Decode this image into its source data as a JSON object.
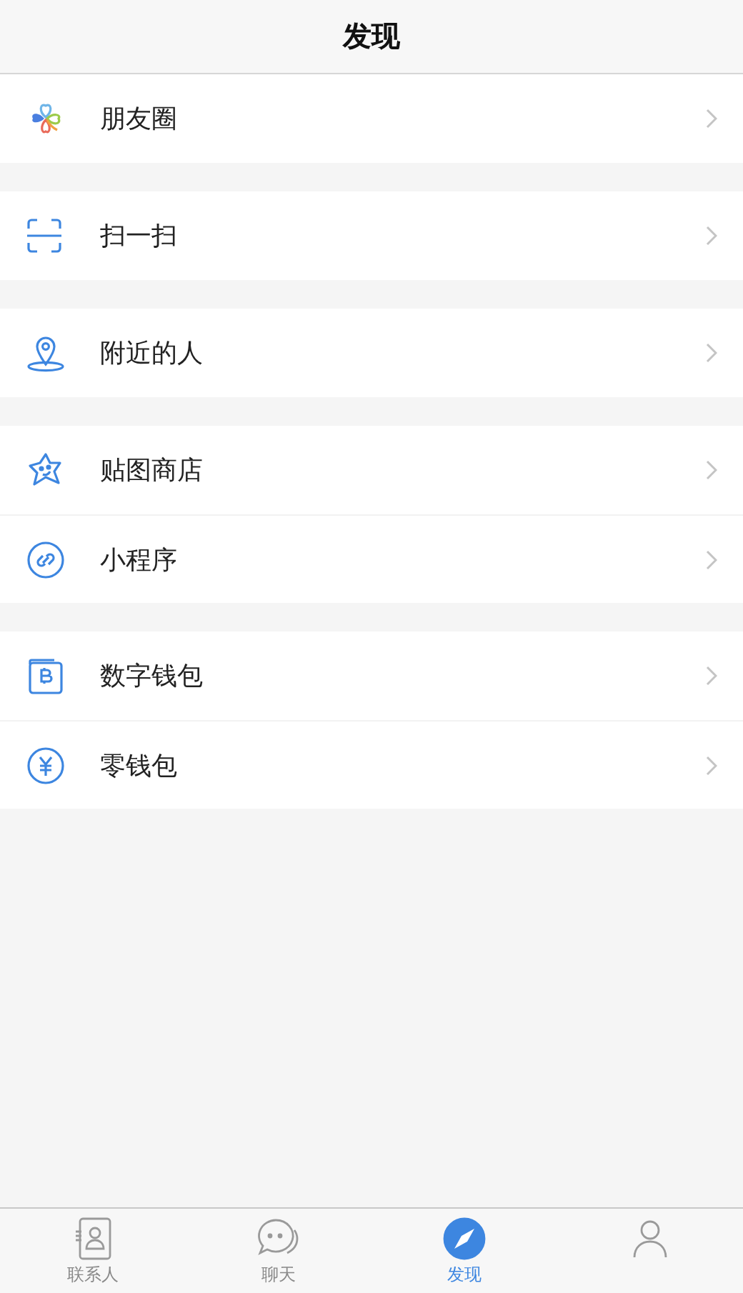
{
  "header": {
    "title": "发现"
  },
  "groups": [
    {
      "items": [
        {
          "kind": "moments",
          "label": "朋友圈"
        }
      ]
    },
    {
      "items": [
        {
          "kind": "scan",
          "label": "扫一扫"
        }
      ]
    },
    {
      "items": [
        {
          "kind": "nearby",
          "label": "附近的人"
        }
      ]
    },
    {
      "items": [
        {
          "kind": "sticker",
          "label": "贴图商店"
        },
        {
          "kind": "miniprogram",
          "label": "小程序"
        }
      ]
    },
    {
      "items": [
        {
          "kind": "digital-wallet",
          "label": "数字钱包"
        },
        {
          "kind": "wallet",
          "label": "零钱包"
        }
      ]
    }
  ],
  "tab_bar": [
    {
      "kind": "contacts",
      "label": "联系人",
      "selected": false
    },
    {
      "kind": "chat",
      "label": "聊天",
      "selected": false
    },
    {
      "kind": "discover",
      "label": "发现",
      "selected": true
    },
    {
      "kind": "me",
      "selected": false
    }
  ]
}
